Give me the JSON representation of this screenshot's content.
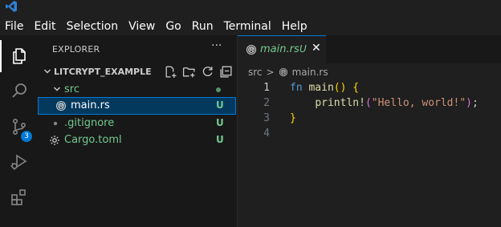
{
  "menu": [
    "File",
    "Edit",
    "Selection",
    "View",
    "Go",
    "Run",
    "Terminal",
    "Help"
  ],
  "activity_bar": {
    "items": [
      "explorer-icon",
      "search-icon",
      "source-control-icon",
      "run-debug-icon",
      "extensions-icon"
    ],
    "source_control_badge": "3"
  },
  "explorer": {
    "header": "EXPLORER",
    "more": "···",
    "project_name": "LITCRYPT_EXAMPLE",
    "tree": [
      {
        "label": "src",
        "status": "",
        "type": "folder"
      },
      {
        "label": "main.rs",
        "status": "U",
        "type": "rust-file"
      },
      {
        "label": ".gitignore",
        "status": "U",
        "type": "git-file"
      },
      {
        "label": "Cargo.toml",
        "status": "U",
        "type": "toml-file"
      }
    ]
  },
  "editor": {
    "tab": {
      "name": "main.rs",
      "status": "U",
      "close": "✕"
    },
    "breadcrumb": {
      "folder": "src",
      "separator": ">",
      "file": "main.rs"
    },
    "line_numbers": [
      "1",
      "2",
      "3",
      "4"
    ],
    "code": {
      "l1_kw": "fn",
      "l1_fn": "main",
      "l1_paren": "()",
      "l1_brace": "{",
      "l2_indent": "    ",
      "l2_macro": "println!",
      "l2_open": "(",
      "l2_str": "\"Hello, world!\"",
      "l2_close": ")",
      "l2_semi": ";",
      "l3_brace": "}"
    }
  },
  "colors": {
    "accent": "#0078d4",
    "untracked": "#73c991",
    "keyword": "#569cd6",
    "function": "#dcdcaa",
    "string": "#ce9178",
    "bracket": "#ffd700"
  }
}
